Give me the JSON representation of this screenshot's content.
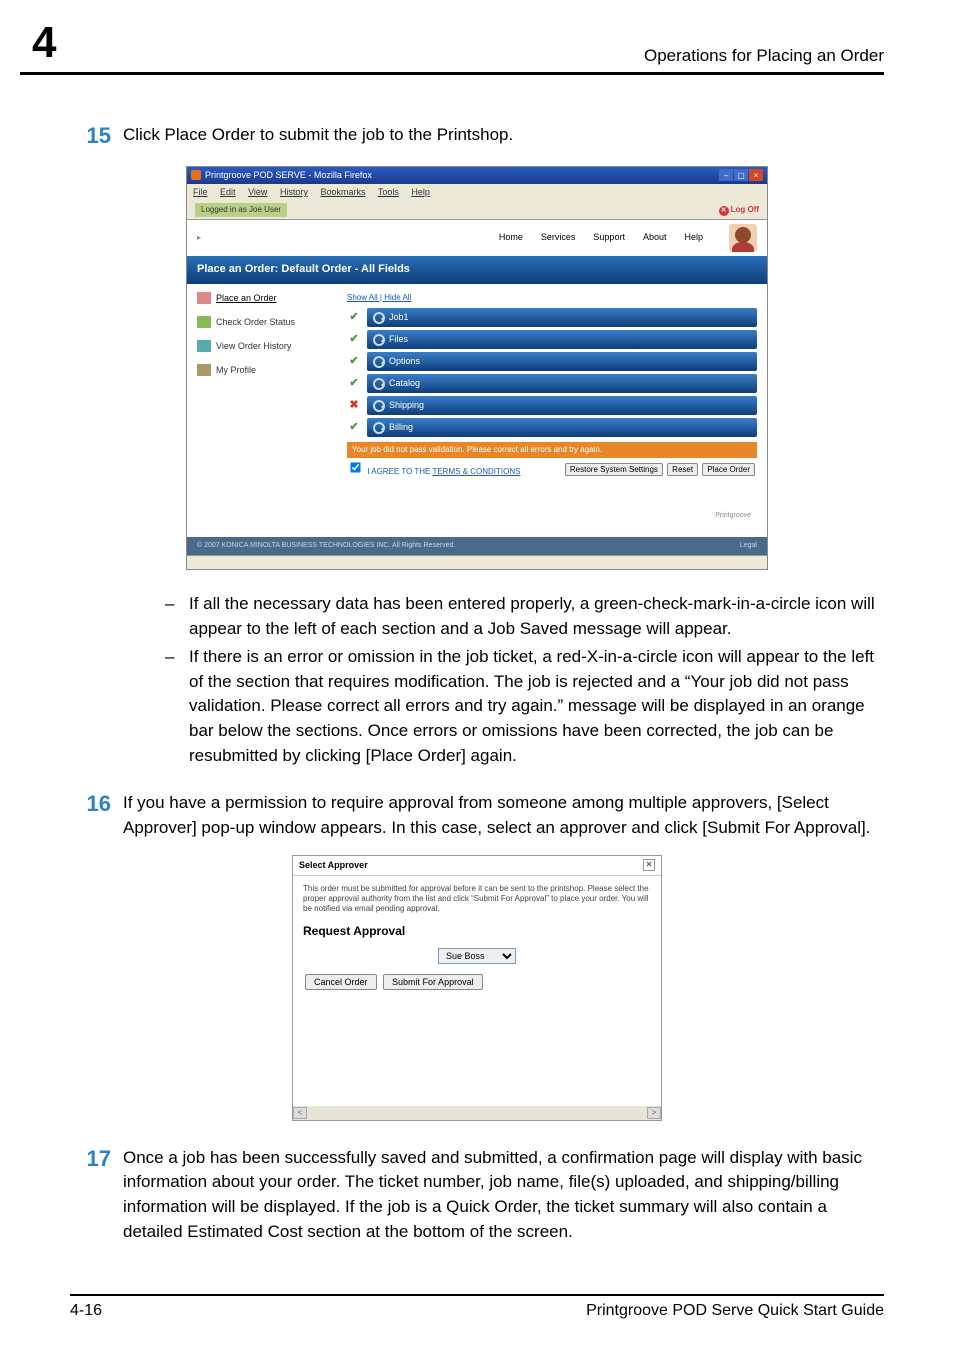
{
  "page": {
    "chapter_num": "4",
    "header_right": "Operations for Placing an Order",
    "footer_left": "4-16",
    "footer_right": "Printgroove POD Serve Quick Start Guide"
  },
  "step15": {
    "num": "15",
    "text": "Click Place Order to submit the job to the Printshop."
  },
  "ss1": {
    "title": "Printgroove POD SERVE - Mozilla Firefox",
    "menu": {
      "file": "File",
      "edit": "Edit",
      "view": "View",
      "history": "History",
      "bookmarks": "Bookmarks",
      "tools": "Tools",
      "help": "Help"
    },
    "loginbar": "Logged in as Joe User",
    "logoff": "Log Off",
    "nav": {
      "home": "Home",
      "services": "Services",
      "support": "Support",
      "about": "About",
      "help": "Help"
    },
    "bluebar": "Place an Order: Default Order - All Fields",
    "sidebar": {
      "place": "Place an Order",
      "status": "Check Order Status",
      "history": "View Order History",
      "profile": "My Profile"
    },
    "showhide": "Show All | Hide All",
    "sections": {
      "job": "Job1",
      "files": "Files",
      "options": "Options",
      "catalog": "Catalog",
      "shipping": "Shipping",
      "billing": "Billing"
    },
    "errbar": "Your job did not pass validation. Please correct all errors and try again.",
    "agree_prefix": "I AGREE TO THE ",
    "agree_link": "TERMS & CONDITIONS",
    "btns": {
      "restore": "Restore System Settings",
      "reset": "Reset",
      "place": "Place Order"
    },
    "footer_text": "© 2007 KONICA MINOLTA BUSINESS TECHNOLOGIES INC. All Rights Reserved.",
    "footer_link": "Legal",
    "badge": "Printgroove"
  },
  "bullets": {
    "b1": "If all the necessary data has been entered properly, a green-check-mark-in-a-circle icon will appear to the left of each section and a Job Saved message will appear.",
    "b2": "If there is an error or omission in the job ticket, a red-X-in-a-circle icon will appear to the left of the section that requires modification. The job is rejected and a “Your job did not pass validation. Please correct all errors and try again.” message will be displayed in an orange bar below the sections. Once errors or omissions have been corrected, the job can be resubmitted by clicking [Place Order] again."
  },
  "step16": {
    "num": "16",
    "text": "If you have a permission to require approval from someone among multiple approvers, [Select Approver] pop-up window appears. In this case, select an approver and click [Submit For Approval]."
  },
  "ss2": {
    "title": "Select Approver",
    "note": "This order must be submitted for approval before it can be sent to the printshop. Please select the proper approval authority from the list and click “Submit For Approval” to place your order. You will be notified via email pending approval.",
    "heading": "Request Approval",
    "select_value": "Sue Boss",
    "cancel": "Cancel Order",
    "submit": "Submit For Approval"
  },
  "step17": {
    "num": "17",
    "text": "Once a job has been successfully saved and submitted, a confirmation page will display with basic information about your order. The ticket number, job name, file(s) uploaded, and shipping/billing information will be displayed. If the job is a Quick Order, the ticket summary will also contain a detailed Estimated Cost section at the bottom of the screen."
  }
}
